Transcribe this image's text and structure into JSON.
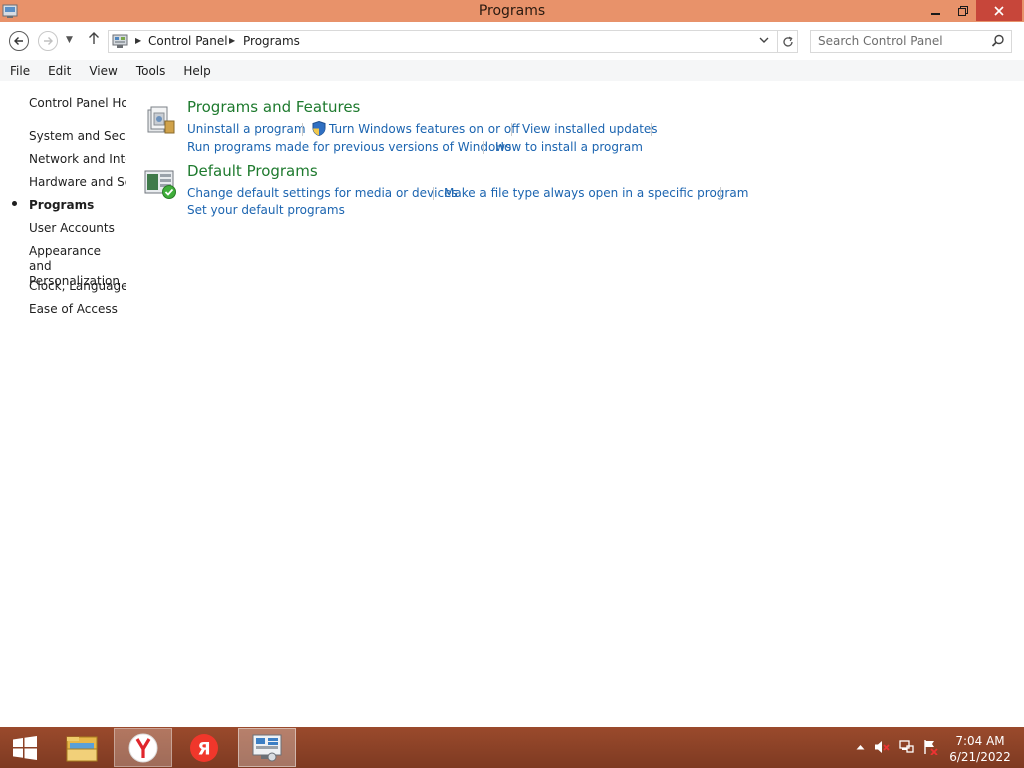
{
  "window": {
    "title": "Programs"
  },
  "address": {
    "crumbs": [
      "Control Panel",
      "Programs"
    ]
  },
  "search": {
    "placeholder": "Search Control Panel"
  },
  "menu": [
    "File",
    "Edit",
    "View",
    "Tools",
    "Help"
  ],
  "sidebar": {
    "items": [
      {
        "label": "Control Panel Home"
      },
      {
        "label": "System and Security"
      },
      {
        "label": "Network and Internet"
      },
      {
        "label": "Hardware and Sound"
      },
      {
        "label": "Programs"
      },
      {
        "label": "User Accounts"
      },
      {
        "label": "Appearance and Personalization"
      },
      {
        "label": "Clock, Language, and Region"
      },
      {
        "label": "Ease of Access"
      }
    ],
    "active": "Programs"
  },
  "categories": [
    {
      "title": "Programs and Features",
      "links": [
        "Uninstall a program",
        "Turn Windows features on or off",
        "View installed updates",
        "Run programs made for previous versions of Windows",
        "How to install a program"
      ]
    },
    {
      "title": "Default Programs",
      "links": [
        "Change default settings for media or devices",
        "Make a file type always open in a specific program",
        "Set your default programs"
      ]
    }
  ],
  "taskbar": {
    "yandex_letter": "Я",
    "time": "7:04 AM",
    "date": "6/21/2022"
  },
  "colors": {
    "titlebar": "#e8926a",
    "link": "#1b64b0",
    "category_title": "#1e7a2e",
    "taskbar": "#8a4126"
  }
}
